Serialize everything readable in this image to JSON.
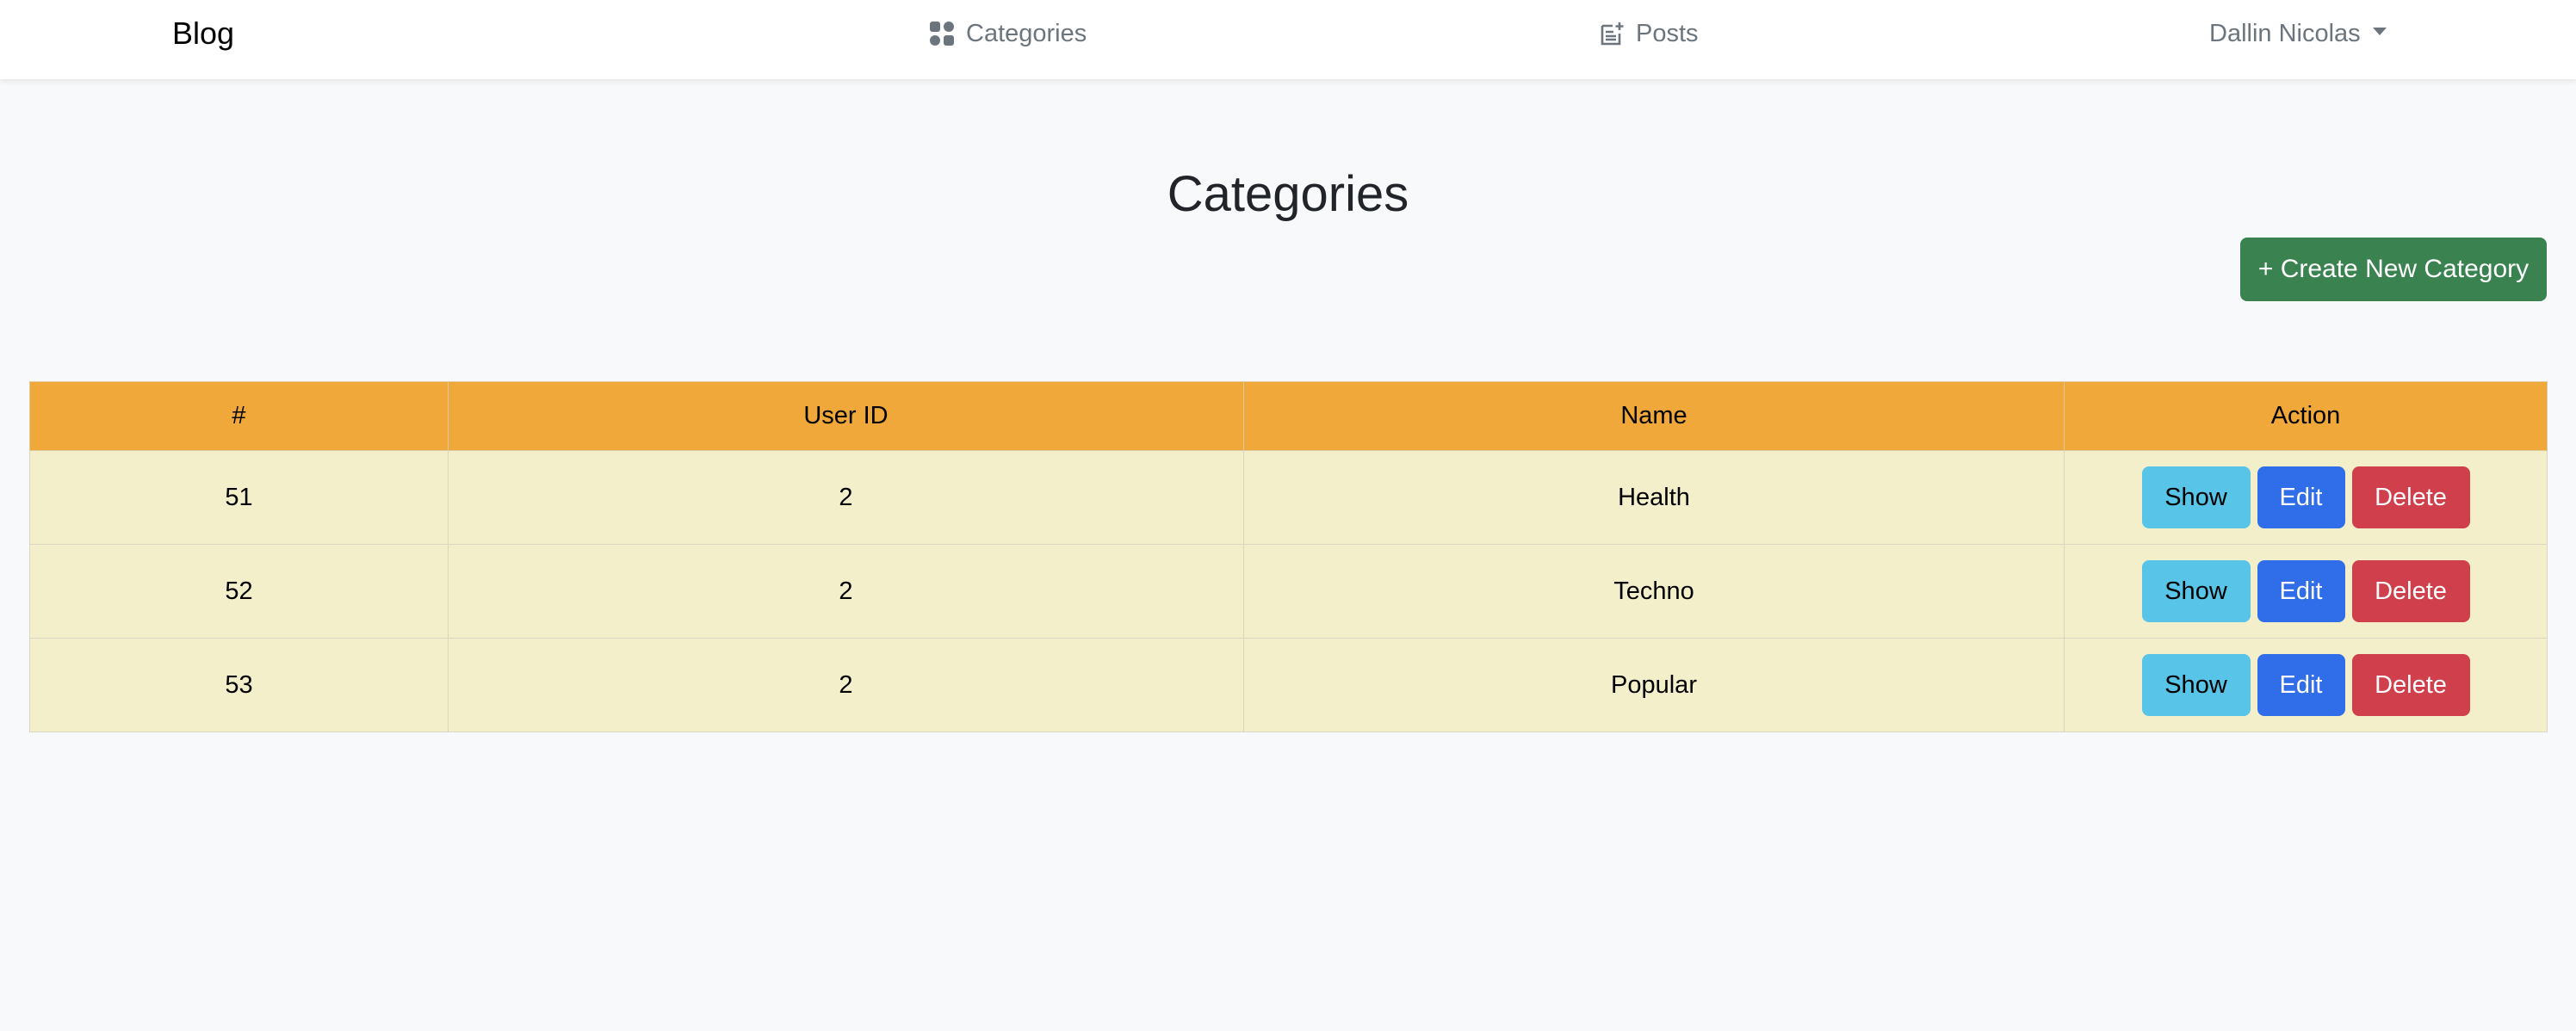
{
  "navbar": {
    "brand": "Blog",
    "categories_label": "Categories",
    "posts_label": "Posts",
    "user_name": "Dallin Nicolas"
  },
  "page": {
    "title": "Categories",
    "create_button_label": "+ Create New Category"
  },
  "table": {
    "headers": [
      "#",
      "User ID",
      "Name",
      "Action"
    ],
    "rows": [
      {
        "id": "51",
        "user_id": "2",
        "name": "Health"
      },
      {
        "id": "52",
        "user_id": "2",
        "name": "Techno"
      },
      {
        "id": "53",
        "user_id": "2",
        "name": "Popular"
      }
    ],
    "actions": {
      "show": "Show",
      "edit": "Edit",
      "delete": "Delete"
    }
  },
  "colors": {
    "header_bg": "#f0a83a",
    "row_bg": "#f3efcb",
    "create_button": "#3a8350",
    "show_button": "#58c4e8",
    "edit_button": "#2f6ee8",
    "delete_button": "#cf404c"
  },
  "icons": {
    "categories": "grid-icon",
    "posts": "post-add-icon",
    "user_menu": "caret-down-icon"
  }
}
